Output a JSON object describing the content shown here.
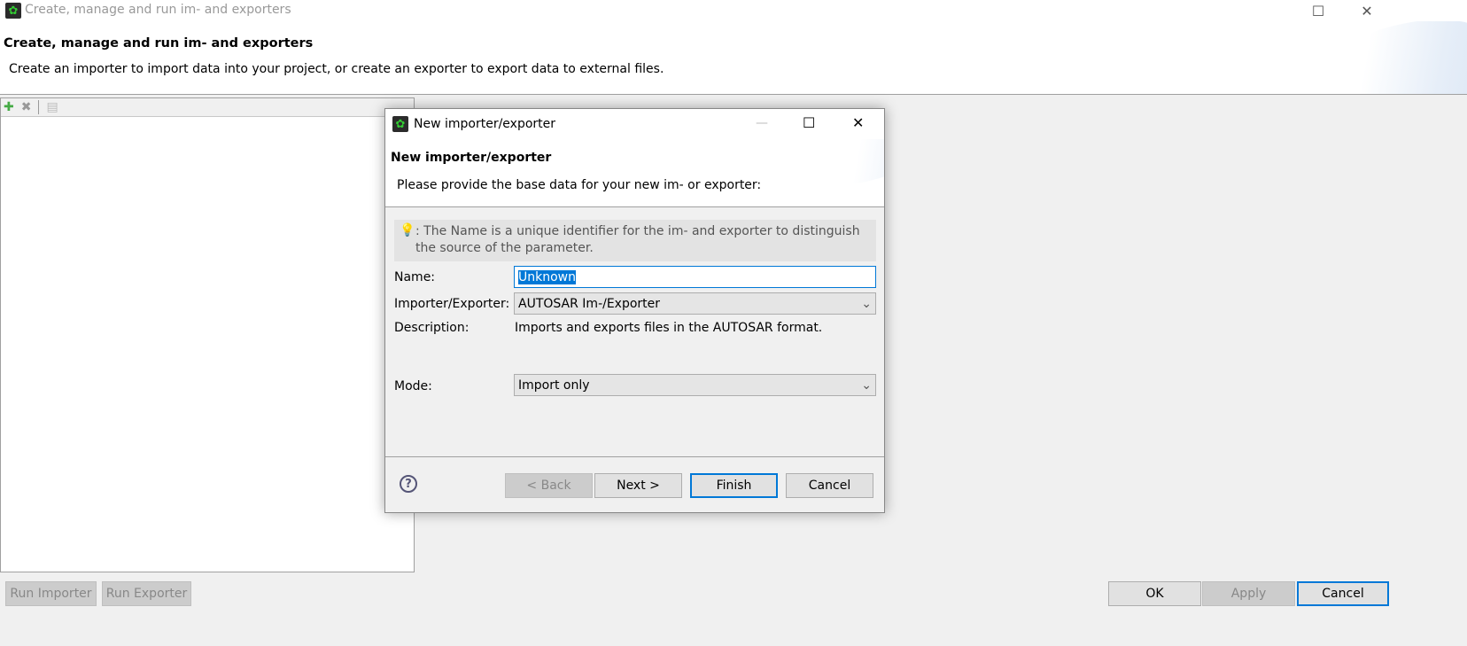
{
  "window": {
    "title": "Create, manage and run im- and exporters"
  },
  "header": {
    "title": "Create, manage and run im- and exporters",
    "subtitle": "Create an importer to import data into your project, or create an exporter to export data to external files."
  },
  "toolbar": {
    "icons": [
      "add-icon",
      "delete-icon",
      "copy-icon"
    ]
  },
  "bottom": {
    "run_importer": "Run Importer",
    "run_exporter": "Run Exporter",
    "ok": "OK",
    "apply": "Apply",
    "cancel": "Cancel"
  },
  "dialog": {
    "title": "New importer/exporter",
    "heading": "New importer/exporter",
    "description": "Please provide the base data for your new im- or exporter:",
    "info": ": The Name is a unique identifier for the im- and exporter to distinguish the source of the parameter.",
    "name_label": "Name:",
    "name_value": "Unknown",
    "type_label": "Importer/Exporter:",
    "type_value": "AUTOSAR Im-/Exporter",
    "desc_label": "Description:",
    "desc_value": "Imports and exports files in the AUTOSAR format.",
    "mode_label": "Mode:",
    "mode_value": "Import only",
    "back": "< Back",
    "next": "Next >",
    "finish": "Finish",
    "cancel": "Cancel"
  },
  "colors": {
    "accent": "#0078d7",
    "selection": "#0078d7"
  }
}
